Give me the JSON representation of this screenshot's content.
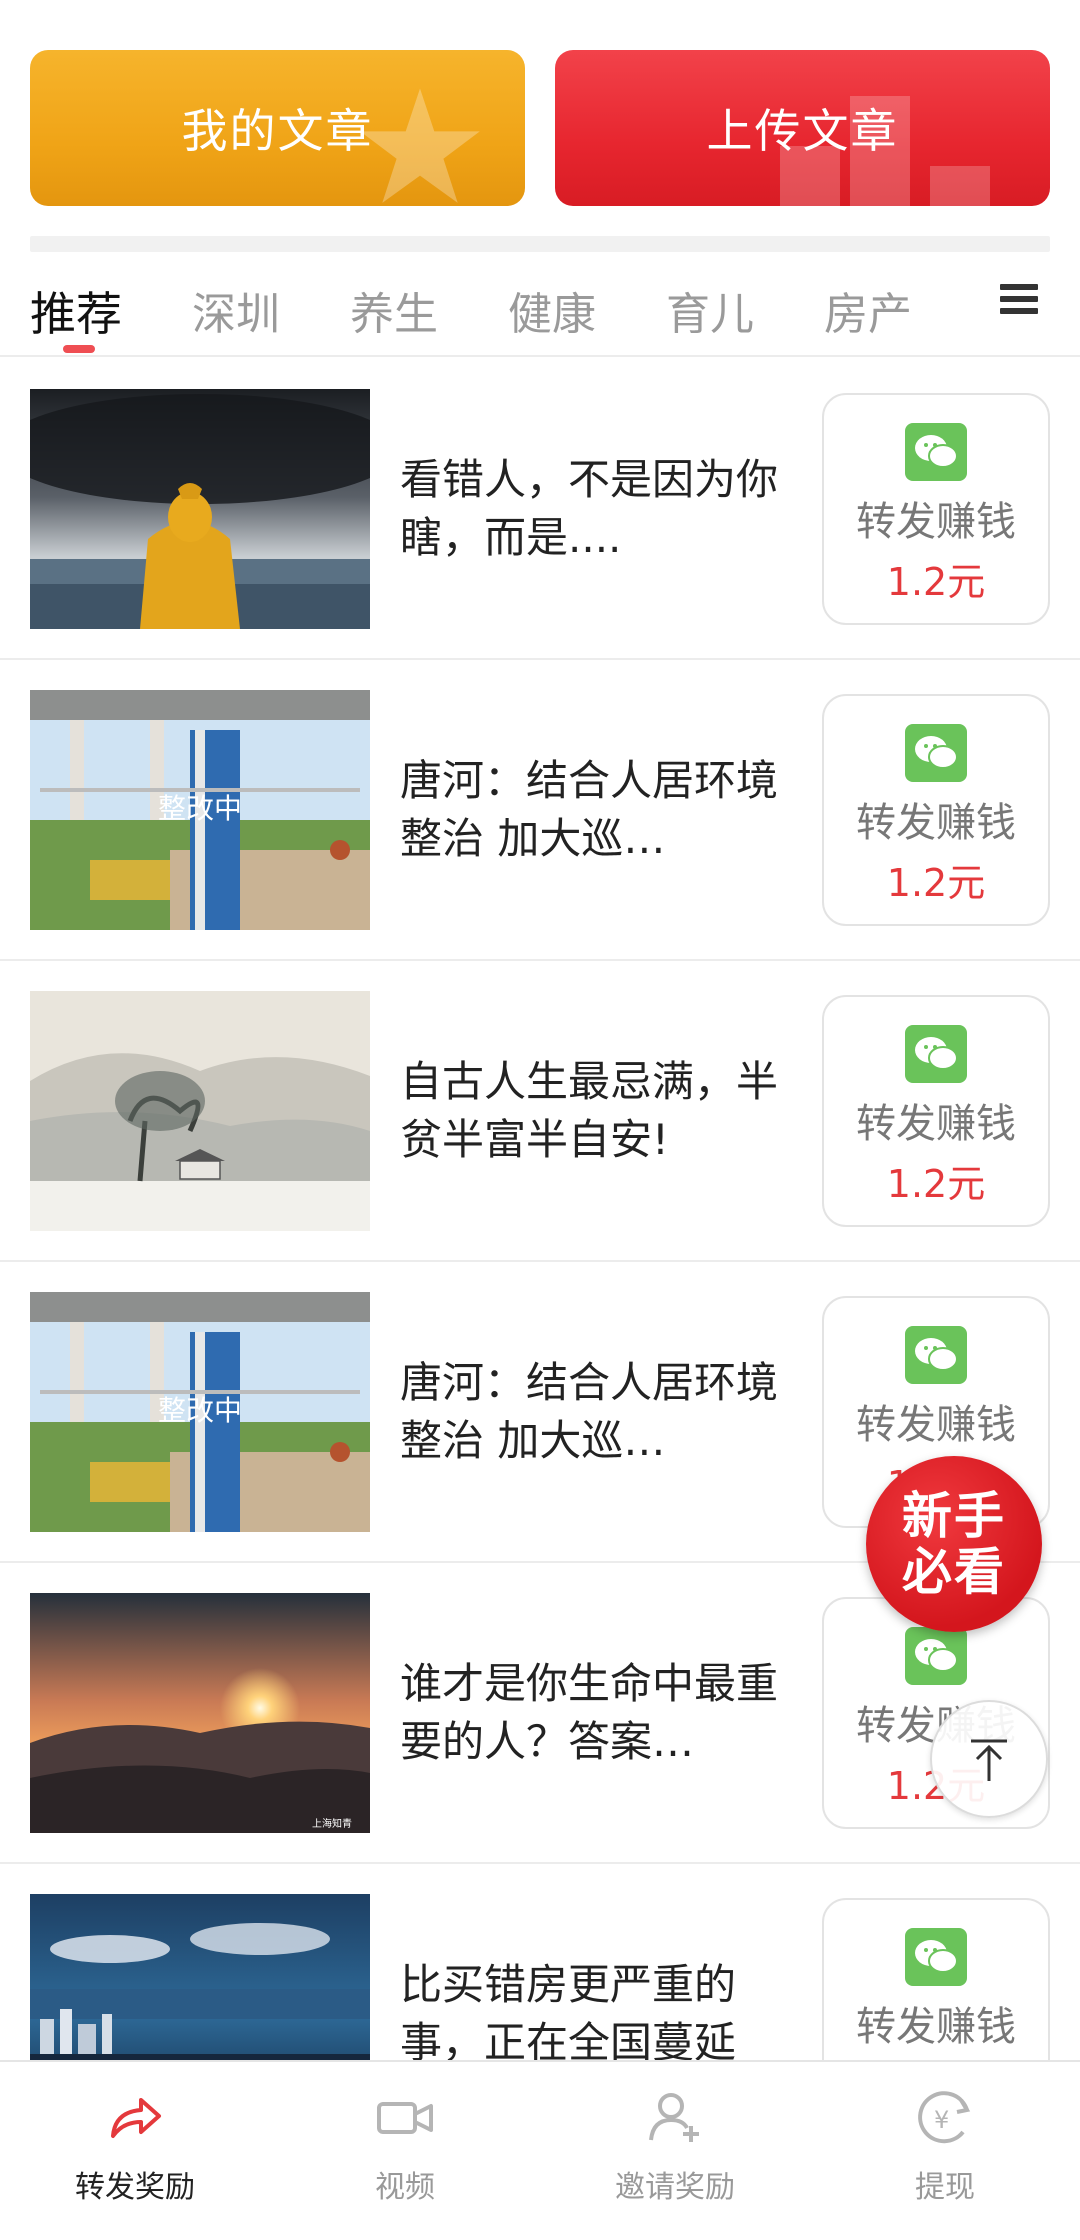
{
  "top": {
    "my_articles": "我的文章",
    "upload_article": "上传文章"
  },
  "tabs": [
    "推荐",
    "深圳",
    "养生",
    "健康",
    "育儿",
    "房产"
  ],
  "active_tab": "推荐",
  "articles": [
    {
      "title": "看错人，不是因为你瞎，而是....",
      "share_label": "转发赚钱",
      "amount": "1.2元",
      "thumb": "storm"
    },
    {
      "title": "唐河：结合人居环境整治 加大巡…",
      "share_label": "转发赚钱",
      "amount": "1.2元",
      "thumb": "construction",
      "overlay": "整改中"
    },
    {
      "title": "自古人生最忌满，半贫半富半自安!",
      "share_label": "转发赚钱",
      "amount": "1.2元",
      "thumb": "painting"
    },
    {
      "title": "唐河：结合人居环境整治 加大巡…",
      "share_label": "转发赚钱",
      "amount": "1.2元",
      "thumb": "construction",
      "overlay": "整改中"
    },
    {
      "title": "谁才是你生命中最重要的人？答案…",
      "share_label": "转发赚钱",
      "amount": "1.2元",
      "thumb": "sunset",
      "watermark": "上海知青"
    },
    {
      "title": "比买错房更严重的事，正在全国蔓延",
      "share_label": "转发赚钱",
      "amount": "",
      "thumb": "city"
    }
  ],
  "floating": {
    "newbie_line1": "新手",
    "newbie_line2": "必看"
  },
  "bottom_nav": [
    {
      "label": "转发奖励",
      "icon": "share-arrow-icon",
      "active": true
    },
    {
      "label": "视频",
      "icon": "video-camera-icon",
      "active": false
    },
    {
      "label": "邀请奖励",
      "icon": "invite-user-icon",
      "active": false
    },
    {
      "label": "提现",
      "icon": "withdraw-yuan-icon",
      "active": false
    }
  ],
  "colors": {
    "accent_red": "#e4393c",
    "banner_orange": "#f0a417",
    "banner_red": "#e7262f",
    "wechat_green": "#6ac35a"
  }
}
